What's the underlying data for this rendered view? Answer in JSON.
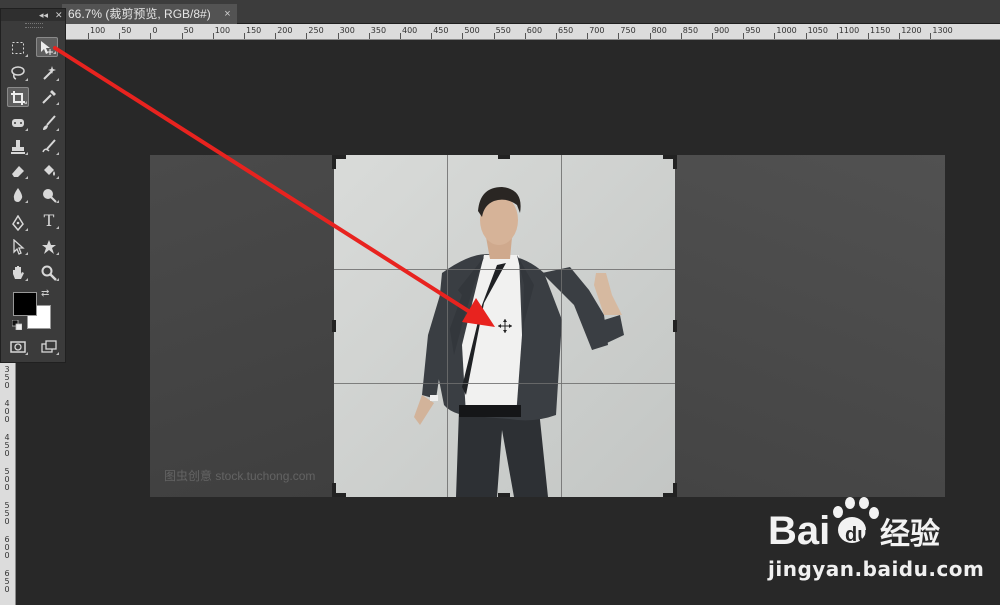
{
  "document_tab": {
    "title": "66.7% (裁剪预览, RGB/8#)",
    "close_label": "×"
  },
  "toolbox": {
    "collapse_label": "◂◂",
    "close_label": "✕",
    "tools": [
      {
        "name": "rectangular-marquee-tool",
        "icon": "marquee-icon"
      },
      {
        "name": "move-tool",
        "icon": "move-icon",
        "active": true
      },
      {
        "name": "lasso-tool",
        "icon": "lasso-icon"
      },
      {
        "name": "magic-wand-tool",
        "icon": "magic-wand-icon"
      },
      {
        "name": "crop-tool",
        "icon": "crop-icon"
      },
      {
        "name": "eyedropper-tool",
        "icon": "eyedropper-icon"
      },
      {
        "name": "spot-healing-tool",
        "icon": "healing-icon"
      },
      {
        "name": "brush-tool",
        "icon": "brush-icon"
      },
      {
        "name": "clone-stamp-tool",
        "icon": "stamp-icon"
      },
      {
        "name": "history-brush-tool",
        "icon": "history-brush-icon"
      },
      {
        "name": "eraser-tool",
        "icon": "eraser-icon"
      },
      {
        "name": "paint-bucket-tool",
        "icon": "bucket-icon"
      },
      {
        "name": "blur-tool",
        "icon": "drop-icon"
      },
      {
        "name": "dodge-tool",
        "icon": "dodge-icon"
      },
      {
        "name": "pen-tool",
        "icon": "pen-icon"
      },
      {
        "name": "type-tool",
        "icon": "type-icon",
        "label": "T"
      },
      {
        "name": "path-selection-tool",
        "icon": "path-select-icon"
      },
      {
        "name": "custom-shape-tool",
        "icon": "shape-icon"
      },
      {
        "name": "hand-tool",
        "icon": "hand-icon"
      },
      {
        "name": "zoom-tool",
        "icon": "zoom-icon"
      },
      {
        "name": "quick-mask-button",
        "icon": "quick-mask-icon"
      },
      {
        "name": "screen-mode-button",
        "icon": "screen-mode-icon"
      }
    ],
    "foreground_color": "#000000",
    "background_color": "#ffffff"
  },
  "rulers": {
    "top_labels": [
      "100",
      "50",
      "0",
      "50",
      "100",
      "150",
      "200",
      "250",
      "300",
      "350",
      "400",
      "450",
      "500",
      "550",
      "600",
      "650",
      "700",
      "750",
      "800",
      "850",
      "900",
      "950",
      "1000",
      "1050",
      "1100",
      "1150",
      "1200",
      "1300"
    ],
    "left_labels": [
      "350",
      "400",
      "450",
      "500",
      "550",
      "600",
      "650"
    ]
  },
  "canvas": {
    "watermark": "图虫创意 stock.tuchong.com",
    "accent_arrow_color": "#e8231f"
  },
  "branding": {
    "baidu_logo_text": "Bai du 经验",
    "url": "jingyan.baidu.com"
  }
}
